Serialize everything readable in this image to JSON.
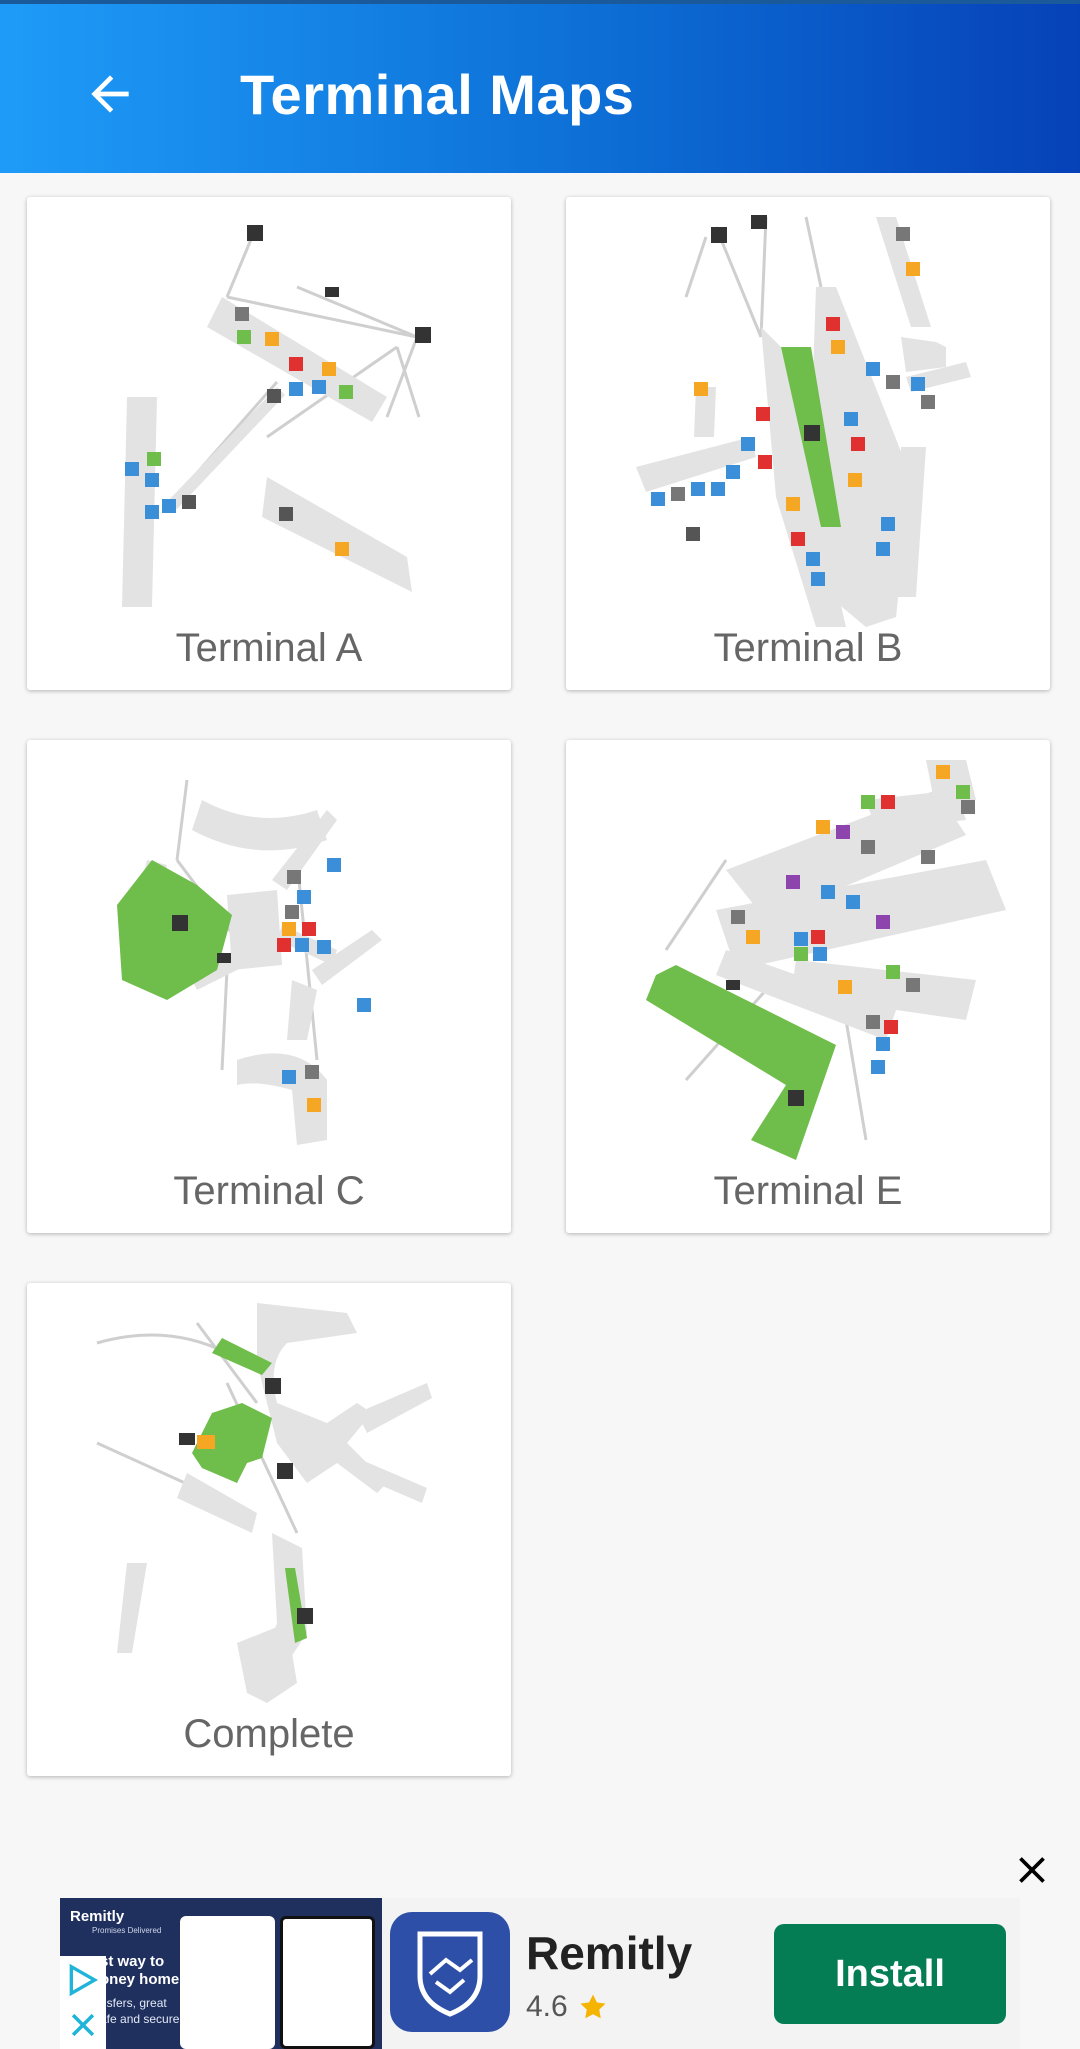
{
  "header": {
    "title": "Terminal Maps",
    "back_icon": "arrow-left-icon"
  },
  "cards": [
    {
      "label": "Terminal A"
    },
    {
      "label": "Terminal B"
    },
    {
      "label": "Terminal C"
    },
    {
      "label": "Terminal E"
    },
    {
      "label": "Complete"
    }
  ],
  "ad": {
    "app_name": "Remitly",
    "rating": "4.6",
    "install_label": "Install",
    "close_icon": "close-icon",
    "screenshot_brand": "Remitly",
    "screenshot_tagline": "Promises Delivered",
    "screenshot_text_1": "st way to",
    "screenshot_text_2": "oney home.",
    "screenshot_text_3": "nsfers, great",
    "screenshot_text_4": "afe and secure"
  },
  "colors": {
    "appbar_start": "#1e9bf8",
    "appbar_end": "#0641b8",
    "install_bg": "#047d54",
    "parking_green": "#6fbd4a"
  }
}
